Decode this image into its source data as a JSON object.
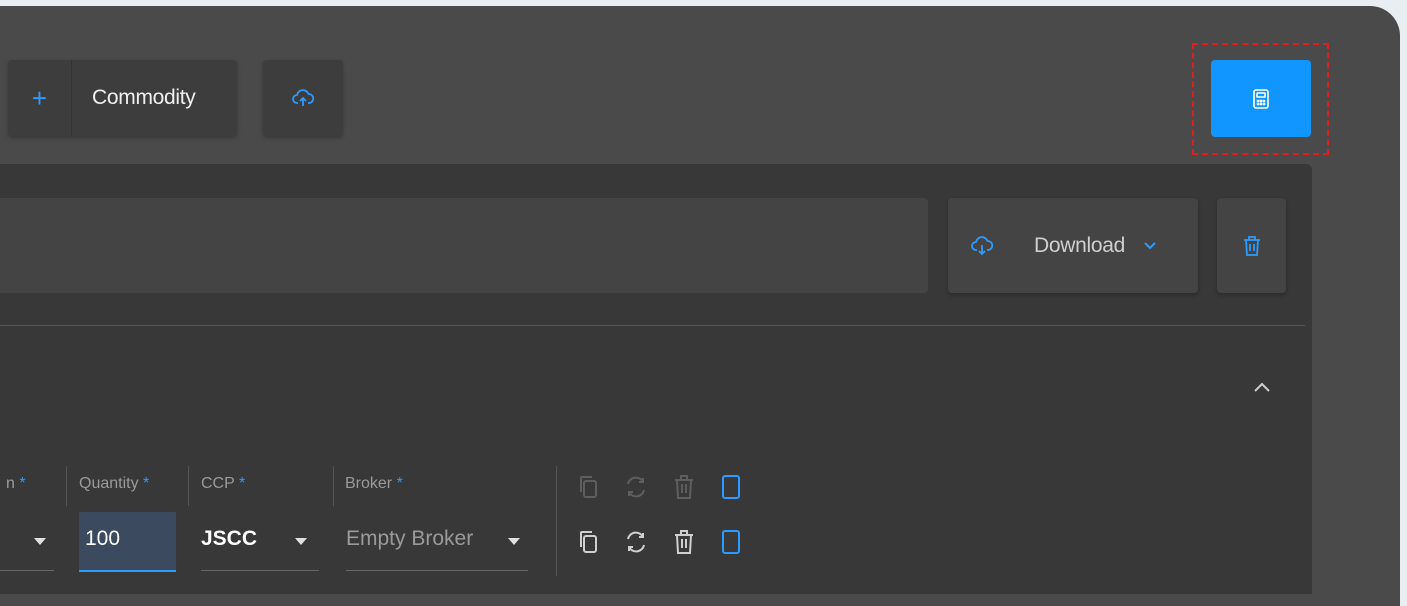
{
  "toolbar": {
    "add_icon": "plus-icon",
    "add_label": "Commodity",
    "upload_icon": "cloud-upload-icon",
    "calculator_icon": "calculator-icon"
  },
  "filters": {
    "download_label": "Download",
    "download_icon": "cloud-download-icon",
    "delete_icon": "trash-icon"
  },
  "table": {
    "columns": [
      {
        "label": "n",
        "required_marker": "*"
      },
      {
        "label": "Quantity",
        "required_marker": "*"
      },
      {
        "label": "CCP",
        "required_marker": "*"
      },
      {
        "label": "Broker",
        "required_marker": "*"
      }
    ],
    "row": {
      "quantity": "100",
      "ccp": "JSCC",
      "broker": "Empty Broker"
    }
  },
  "colors": {
    "accent": "#2b9bff",
    "primary_button": "#1196ff",
    "highlight": "#e01e1e"
  }
}
